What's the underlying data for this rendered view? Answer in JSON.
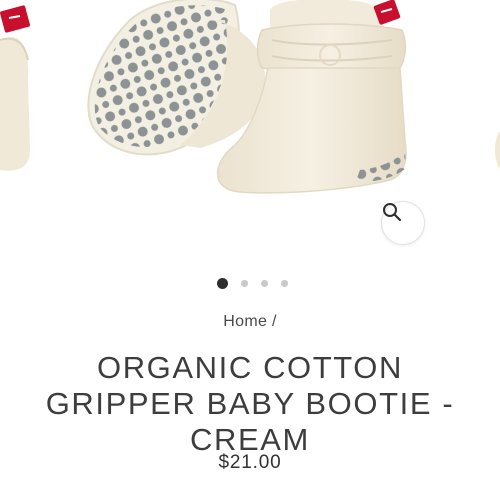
{
  "gallery": {
    "image_alt": "Organic cotton gripper baby bootie in cream with grey polka-dot sole",
    "zoom_icon": "search-icon",
    "slides": 4,
    "active_slide": 1
  },
  "breadcrumb": {
    "home_label": "Home",
    "separator": "/"
  },
  "product": {
    "title": "ORGANIC COTTON GRIPPER BABY BOOTIE - CREAM",
    "price": "$21.00"
  },
  "colors": {
    "cream": "#f3ecdc",
    "sole_dots": "#8d9394",
    "tag_red": "#c8102e",
    "text": "#3d3d3d"
  }
}
